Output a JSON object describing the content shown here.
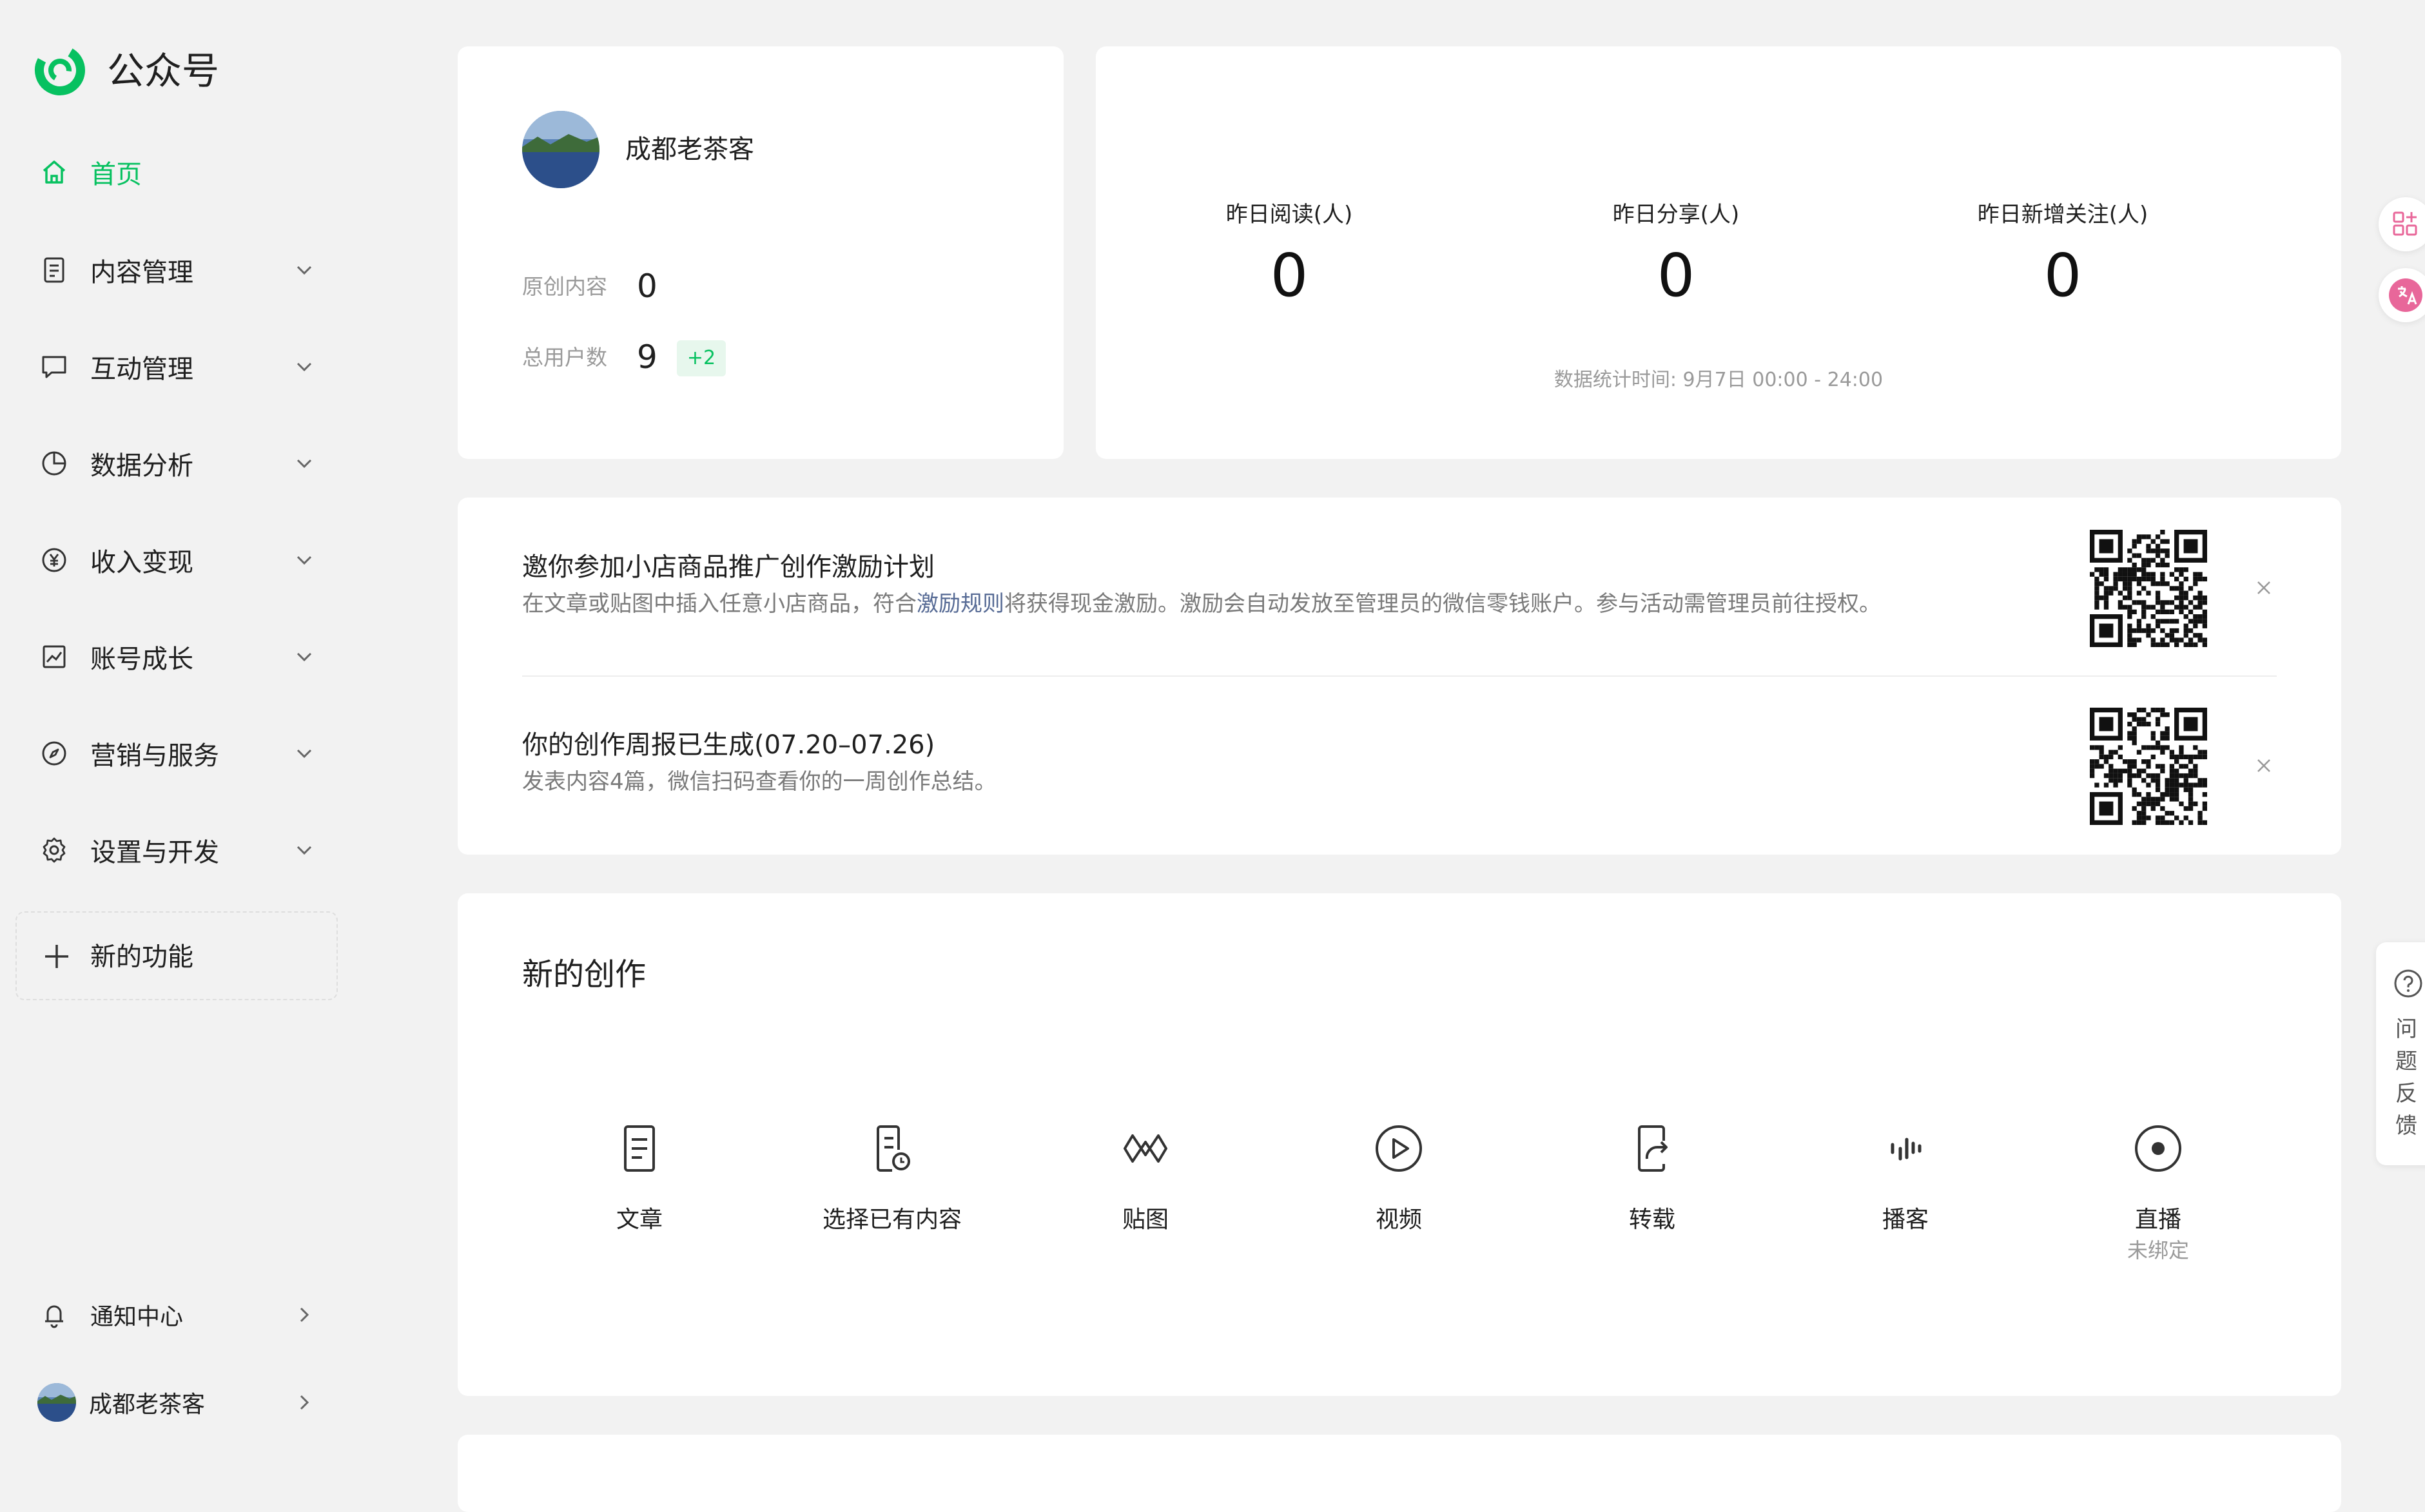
{
  "app": {
    "name": "公众号",
    "brand_color": "#07c160"
  },
  "sidebar": {
    "items": [
      {
        "label": "首页",
        "icon": "home-icon",
        "active": true
      },
      {
        "label": "内容管理",
        "icon": "document-icon"
      },
      {
        "label": "互动管理",
        "icon": "chat-icon"
      },
      {
        "label": "数据分析",
        "icon": "pie-chart-icon"
      },
      {
        "label": "收入变现",
        "icon": "yen-icon"
      },
      {
        "label": "账号成长",
        "icon": "trend-chart-icon"
      },
      {
        "label": "营销与服务",
        "icon": "compass-icon"
      },
      {
        "label": "设置与开发",
        "icon": "gear-icon"
      }
    ],
    "new_feature_label": "新的功能",
    "bottom": {
      "notifications_label": "通知中心",
      "account_label": "成都老茶客"
    }
  },
  "account_card": {
    "name": "成都老茶客",
    "original_label": "原创内容",
    "original_value": "0",
    "users_label": "总用户数",
    "users_value": "9",
    "users_delta": "+2"
  },
  "stats_card": {
    "reads_label": "昨日阅读(人)",
    "reads_value": "0",
    "shares_label": "昨日分享(人)",
    "shares_value": "0",
    "follows_label": "昨日新增关注(人)",
    "follows_value": "0",
    "time_note": "数据统计时间: 9月7日 00:00 - 24:00"
  },
  "notices": [
    {
      "title": "邀你参加小店商品推广创作激励计划",
      "desc_before": "在文章或贴图中插入任意小店商品，符合",
      "desc_link": "激励规则",
      "desc_after": "将获得现金激励。激励会自动发放至管理员的微信零钱账户。参与活动需管理员前往授权。"
    },
    {
      "title": "你的创作周报已生成(07.20–07.26)",
      "desc": "发表内容4篇，微信扫码查看你的一周创作总结。"
    }
  ],
  "creation": {
    "title": "新的创作",
    "tools": [
      {
        "label": "文章",
        "icon": "article-icon"
      },
      {
        "label": "选择已有内容",
        "icon": "existing-content-icon"
      },
      {
        "label": "贴图",
        "icon": "image-post-icon"
      },
      {
        "label": "视频",
        "icon": "video-play-icon"
      },
      {
        "label": "转载",
        "icon": "repost-icon"
      },
      {
        "label": "播客",
        "icon": "podcast-icon"
      },
      {
        "label": "直播",
        "icon": "live-icon",
        "sub": "未绑定"
      }
    ]
  },
  "feedback": {
    "label": "问题反馈"
  }
}
